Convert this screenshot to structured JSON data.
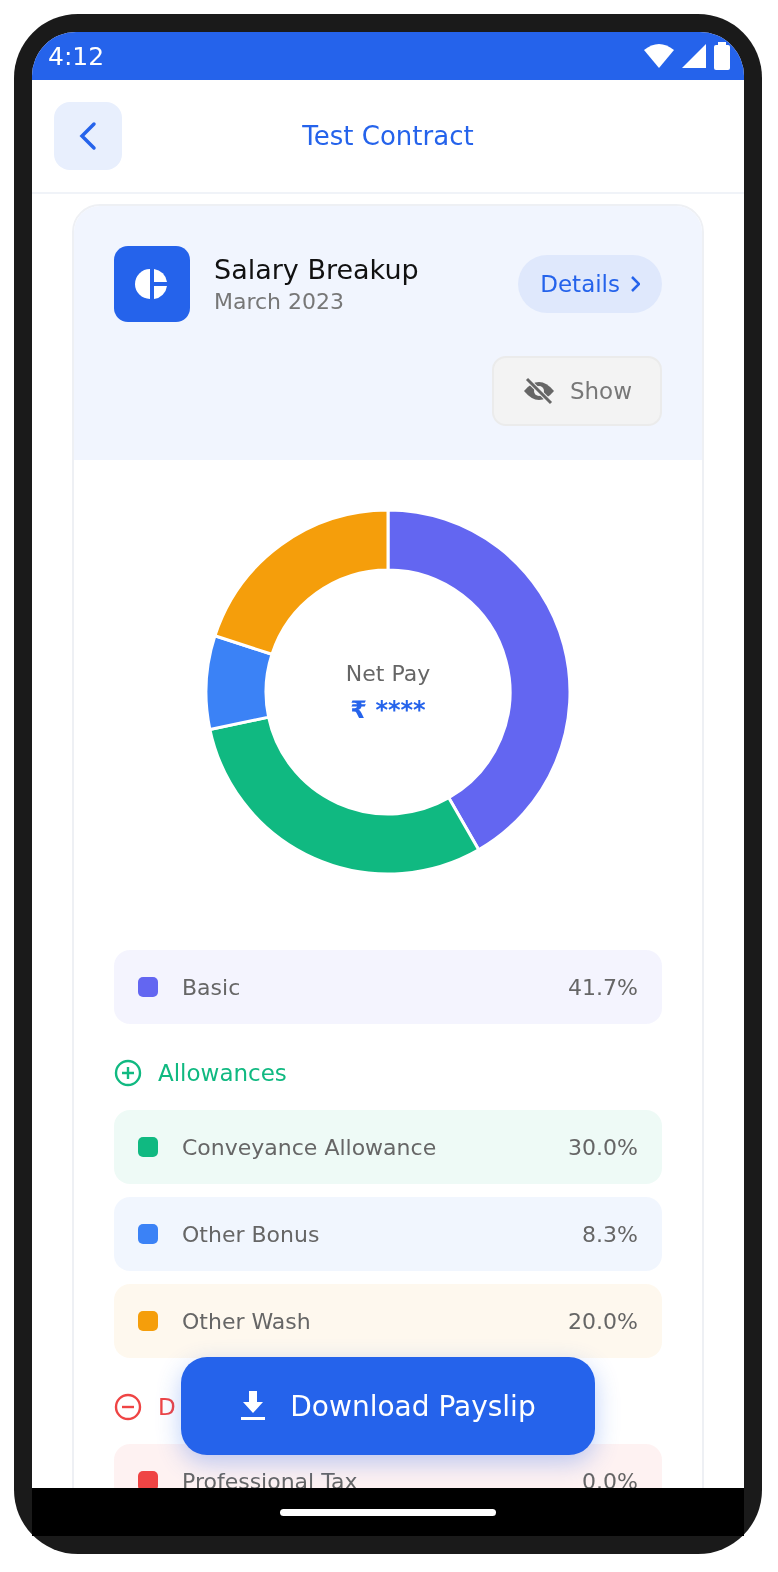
{
  "status_bar": {
    "time": "4:12"
  },
  "header": {
    "title": "Test Contract"
  },
  "card": {
    "title": "Salary Breakup",
    "subtitle": "March 2023",
    "details_button": "Details",
    "show_button": "Show",
    "center_label": "Net Pay",
    "center_value": "₹ ****",
    "chart_data": {
      "type": "donut",
      "values": [
        41.7,
        30.0,
        8.3,
        20.0
      ]
    },
    "groups": [
      {
        "kind": "plain",
        "items": [
          {
            "name": "Basic",
            "value": "41.7%",
            "color": "#6366f1"
          }
        ]
      },
      {
        "kind": "add",
        "heading": "Allowances",
        "items": [
          {
            "name": "Conveyance Allowance",
            "value": "30.0%",
            "color": "#10b981"
          },
          {
            "name": "Other Bonus",
            "value": "8.3%",
            "color": "#3b82f6"
          },
          {
            "name": "Other Wash",
            "value": "20.0%",
            "color": "#f59e0b"
          }
        ]
      },
      {
        "kind": "subtract",
        "heading": "D",
        "items": [
          {
            "name": "Professional Tax",
            "value": "0.0%",
            "color": "#ef4444"
          }
        ]
      }
    ]
  },
  "download_button": "Download Payslip"
}
